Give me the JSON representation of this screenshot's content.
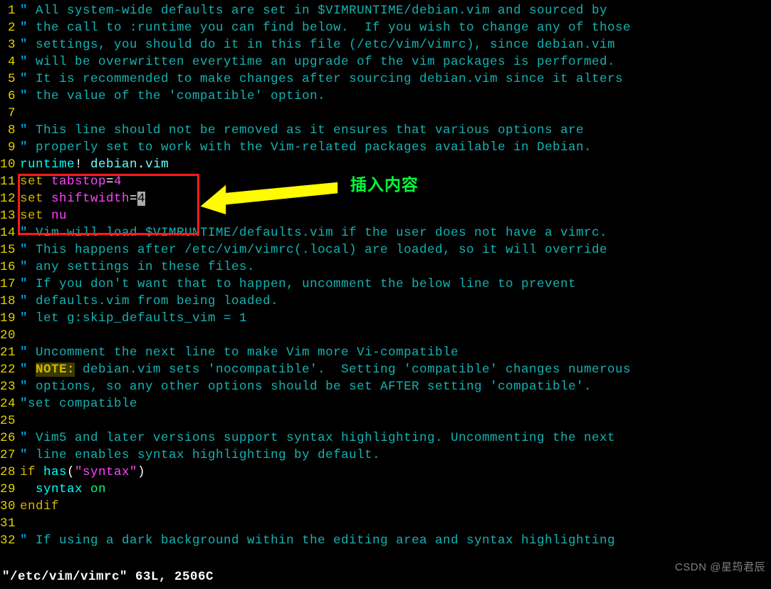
{
  "annotation": {
    "label": "插入内容"
  },
  "status": "\"/etc/vim/vimrc\" 63L, 2506C",
  "watermark": "CSDN @星筠君辰",
  "lines": [
    {
      "n": " 1",
      "seg": [
        [
          "q",
          "\" "
        ],
        [
          "c",
          "All system-wide defaults are set in $VIMRUNTIME/debian.vim and sourced by"
        ]
      ]
    },
    {
      "n": " 2",
      "seg": [
        [
          "q",
          "\" "
        ],
        [
          "c",
          "the call to :runtime you can find below.  If you wish to change any of those"
        ]
      ]
    },
    {
      "n": " 3",
      "seg": [
        [
          "q",
          "\" "
        ],
        [
          "c",
          "settings, you should do it in this file (/etc/vim/vimrc), since debian.vim"
        ]
      ]
    },
    {
      "n": " 4",
      "seg": [
        [
          "q",
          "\" "
        ],
        [
          "c",
          "will be overwritten everytime an upgrade of the vim packages is performed."
        ]
      ]
    },
    {
      "n": " 5",
      "seg": [
        [
          "q",
          "\" "
        ],
        [
          "c",
          "It is recommended to make changes after sourcing debian.vim since it alters"
        ]
      ]
    },
    {
      "n": " 6",
      "seg": [
        [
          "q",
          "\" "
        ],
        [
          "c",
          "the value of the 'compatible' option."
        ]
      ]
    },
    {
      "n": " 7",
      "seg": []
    },
    {
      "n": " 8",
      "seg": [
        [
          "q",
          "\" "
        ],
        [
          "c",
          "This line should not be removed as it ensures that various options are"
        ]
      ]
    },
    {
      "n": " 9",
      "seg": [
        [
          "q",
          "\" "
        ],
        [
          "c",
          "properly set to work with the Vim-related packages available in Debian."
        ]
      ]
    },
    {
      "n": "10",
      "seg": [
        [
          "fn",
          "runtime"
        ],
        [
          "op",
          "! "
        ],
        [
          "id",
          "debian"
        ],
        [
          "op",
          "."
        ],
        [
          "id",
          "vim"
        ]
      ]
    },
    {
      "n": "11",
      "seg": [
        [
          "kw",
          "set "
        ],
        [
          "str",
          "tabstop"
        ],
        [
          "op",
          "="
        ],
        [
          "num",
          "4"
        ]
      ]
    },
    {
      "n": "12",
      "seg": [
        [
          "kw",
          "set "
        ],
        [
          "str",
          "shiftwidth"
        ],
        [
          "op",
          "="
        ],
        [
          "cur",
          "4"
        ]
      ]
    },
    {
      "n": "13",
      "seg": [
        [
          "kw",
          "set "
        ],
        [
          "str",
          "nu"
        ]
      ]
    },
    {
      "n": "14",
      "seg": [
        [
          "q",
          "\" "
        ],
        [
          "c",
          "Vim will load $VIMRUNTIME/defaults.vim if the user does not have a vimrc."
        ]
      ]
    },
    {
      "n": "15",
      "seg": [
        [
          "q",
          "\" "
        ],
        [
          "c",
          "This happens after /etc/vim/vimrc(.local) are loaded, so it will override"
        ]
      ]
    },
    {
      "n": "16",
      "seg": [
        [
          "q",
          "\" "
        ],
        [
          "c",
          "any settings in these files."
        ]
      ]
    },
    {
      "n": "17",
      "seg": [
        [
          "q",
          "\" "
        ],
        [
          "c",
          "If you don't want that to happen, uncomment the below line to prevent"
        ]
      ]
    },
    {
      "n": "18",
      "seg": [
        [
          "q",
          "\" "
        ],
        [
          "c",
          "defaults.vim from being loaded."
        ]
      ]
    },
    {
      "n": "19",
      "seg": [
        [
          "q",
          "\" "
        ],
        [
          "c",
          "let g:skip_defaults_vim = 1"
        ]
      ]
    },
    {
      "n": "20",
      "seg": []
    },
    {
      "n": "21",
      "seg": [
        [
          "q",
          "\" "
        ],
        [
          "c",
          "Uncomment the next line to make Vim more Vi-compatible"
        ]
      ]
    },
    {
      "n": "22",
      "seg": [
        [
          "q",
          "\" "
        ],
        [
          "todo",
          "NOTE:"
        ],
        [
          "c",
          " debian.vim sets 'nocompatible'.  Setting 'compatible' changes numerous"
        ]
      ]
    },
    {
      "n": "23",
      "seg": [
        [
          "q",
          "\" "
        ],
        [
          "c",
          "options, so any other options should be set AFTER setting 'compatible'."
        ]
      ]
    },
    {
      "n": "24",
      "seg": [
        [
          "q",
          "\""
        ],
        [
          "c",
          "set compatible"
        ]
      ]
    },
    {
      "n": "25",
      "seg": []
    },
    {
      "n": "26",
      "seg": [
        [
          "q",
          "\" "
        ],
        [
          "c",
          "Vim5 and later versions support syntax highlighting. Uncommenting the next"
        ]
      ]
    },
    {
      "n": "27",
      "seg": [
        [
          "q",
          "\" "
        ],
        [
          "c",
          "line enables syntax highlighting by default."
        ]
      ]
    },
    {
      "n": "28",
      "seg": [
        [
          "kw",
          "if "
        ],
        [
          "fn",
          "has"
        ],
        [
          "op",
          "("
        ],
        [
          "str",
          "\"syntax\""
        ],
        [
          "op",
          ")"
        ]
      ]
    },
    {
      "n": "29",
      "seg": [
        [
          "op",
          "  "
        ],
        [
          "fn",
          "syntax "
        ],
        [
          "gr",
          "on"
        ]
      ]
    },
    {
      "n": "30",
      "seg": [
        [
          "kw",
          "endif"
        ]
      ]
    },
    {
      "n": "31",
      "seg": []
    },
    {
      "n": "32",
      "seg": [
        [
          "q",
          "\" "
        ],
        [
          "c",
          "If using a dark background within the editing area and syntax highlighting"
        ]
      ]
    }
  ]
}
